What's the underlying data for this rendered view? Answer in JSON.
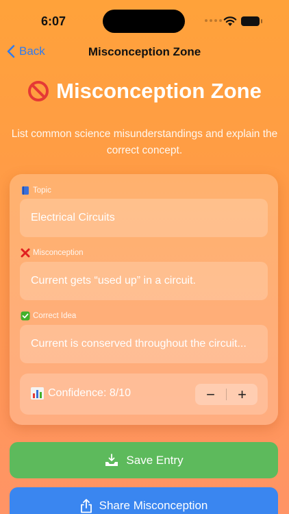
{
  "status_bar": {
    "time": "6:07"
  },
  "nav": {
    "back_label": "Back",
    "title": "Misconception Zone"
  },
  "hero": {
    "title": "Misconception Zone",
    "icon": "no-entry-icon",
    "subtitle": "List common science misunderstandings and explain the correct concept."
  },
  "form": {
    "topic": {
      "label": "Topic",
      "icon": "blue-book-icon",
      "value": "Electrical Circuits"
    },
    "misconception": {
      "label": "Misconception",
      "icon": "cross-mark-icon",
      "value": "Current gets “used up” in a circuit."
    },
    "correct": {
      "label": "Correct Idea",
      "icon": "check-mark-icon",
      "value": "Current is conserved throughout the circuit..."
    },
    "confidence": {
      "label": "Confidence: 8/10",
      "icon": "bar-chart-icon",
      "value": 8,
      "max": 10,
      "minus": "−",
      "plus": "+"
    }
  },
  "actions": {
    "save_label": "Save Entry",
    "share_label": "Share Misconception"
  },
  "colors": {
    "accent": "#2F7BF0",
    "save": "#5DBA5C",
    "share": "#3A86F0",
    "bg_top": "#FFA23A",
    "bg_bottom": "#FF9466"
  }
}
